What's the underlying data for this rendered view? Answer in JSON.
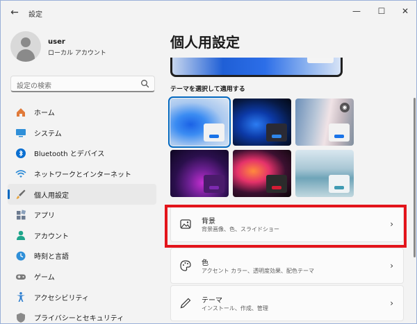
{
  "window": {
    "title": "設定",
    "back": "←",
    "minimize": "—",
    "maximize": "☐",
    "close": "✕"
  },
  "user": {
    "name": "user",
    "account_type": "ローカル アカウント"
  },
  "search": {
    "placeholder": "設定の検索"
  },
  "nav": {
    "items": [
      {
        "label": "ホーム",
        "icon": "home-icon"
      },
      {
        "label": "システム",
        "icon": "system-icon"
      },
      {
        "label": "Bluetooth とデバイス",
        "icon": "bluetooth-icon"
      },
      {
        "label": "ネットワークとインターネット",
        "icon": "wifi-icon"
      },
      {
        "label": "個人用設定",
        "icon": "brush-icon",
        "active": true
      },
      {
        "label": "アプリ",
        "icon": "apps-icon"
      },
      {
        "label": "アカウント",
        "icon": "account-icon"
      },
      {
        "label": "時刻と言語",
        "icon": "globe-clock-icon"
      },
      {
        "label": "ゲーム",
        "icon": "gamepad-icon"
      },
      {
        "label": "アクセシビリティ",
        "icon": "accessibility-icon"
      },
      {
        "label": "プライバシーとセキュリティ",
        "icon": "shield-icon"
      }
    ]
  },
  "main": {
    "title": "個人用設定",
    "themes_label": "テーマを選択して適用する",
    "cards": [
      {
        "title": "背景",
        "subtitle": "背景画像、色、スライドショー",
        "icon": "image-icon"
      },
      {
        "title": "色",
        "subtitle": "アクセント カラー、透明度効果、配色テーマ",
        "icon": "palette-icon"
      },
      {
        "title": "テーマ",
        "subtitle": "インストール、作成、管理",
        "icon": "pen-icon"
      }
    ]
  },
  "colors": {
    "accent": "#0067c0",
    "highlight": "#e3141b"
  }
}
